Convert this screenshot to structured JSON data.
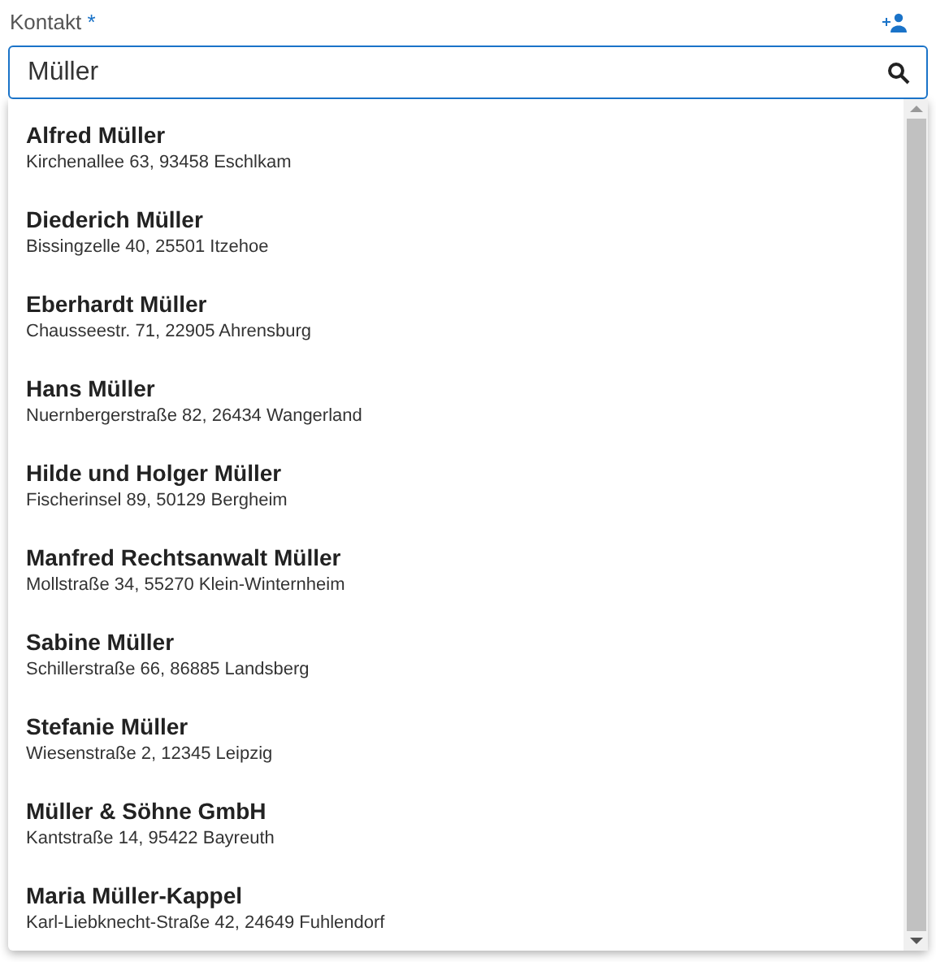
{
  "field": {
    "label": "Kontakt",
    "required_mark": "*",
    "value": "Müller"
  },
  "results": [
    {
      "name": "Alfred Müller",
      "address": "Kirchenallee 63, 93458 Eschlkam"
    },
    {
      "name": "Diederich Müller",
      "address": "Bissingzelle 40, 25501 Itzehoe"
    },
    {
      "name": "Eberhardt Müller",
      "address": "Chausseestr. 71, 22905 Ahrensburg"
    },
    {
      "name": "Hans Müller",
      "address": "Nuernbergerstraße 82, 26434 Wangerland"
    },
    {
      "name": "Hilde und Holger Müller",
      "address": "Fischerinsel 89, 50129 Bergheim"
    },
    {
      "name": "Manfred Rechtsanwalt Müller",
      "address": "Mollstraße 34, 55270 Klein-Winternheim"
    },
    {
      "name": "Sabine Müller",
      "address": "Schillerstraße 66, 86885 Landsberg"
    },
    {
      "name": "Stefanie Müller",
      "address": "Wiesenstraße 2, 12345 Leipzig"
    },
    {
      "name": "Müller & Söhne GmbH",
      "address": "Kantstraße 14, 95422 Bayreuth"
    },
    {
      "name": "Maria Müller-Kappel",
      "address": "Karl-Liebknecht-Straße 42, 24649 Fuhlendorf"
    }
  ]
}
